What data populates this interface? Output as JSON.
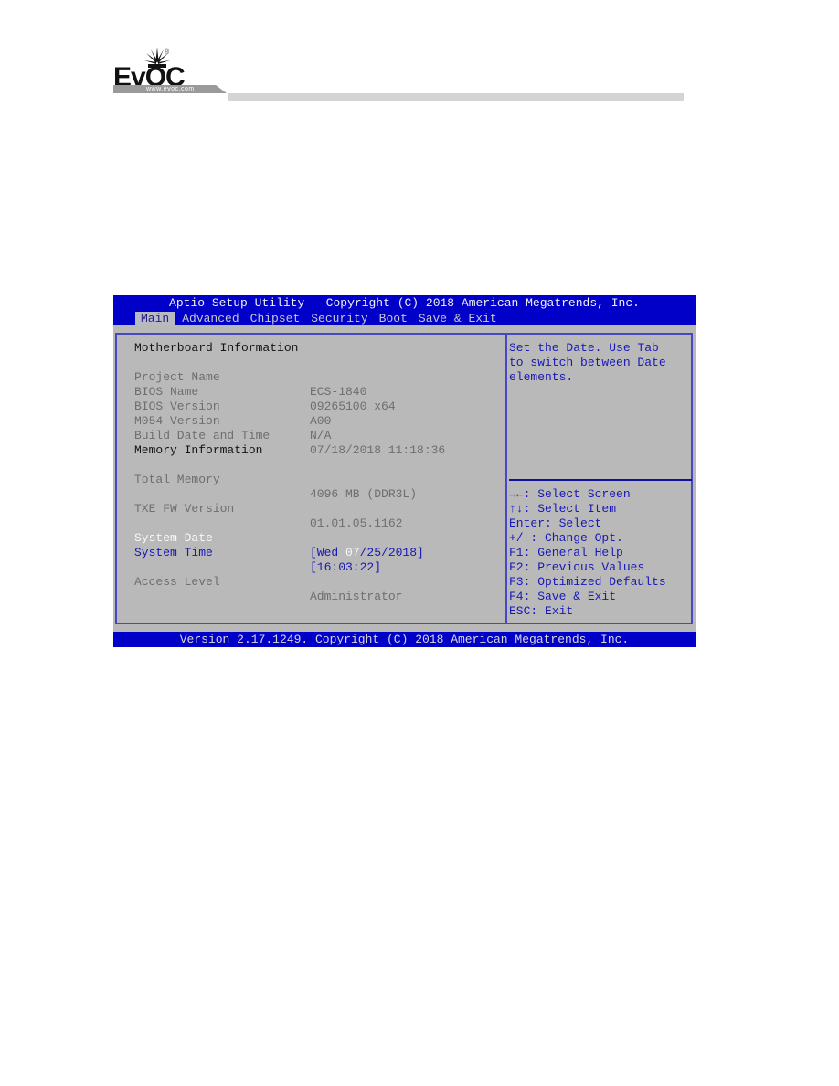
{
  "header": {
    "logo_text": "EvOC",
    "logo_url": "www.evoc.com",
    "registered_mark": "®"
  },
  "bios": {
    "title": "Aptio Setup Utility - Copyright (C) 2018 American Megatrends, Inc.",
    "tabs": [
      {
        "label": "Main",
        "active": true
      },
      {
        "label": "Advanced",
        "active": false
      },
      {
        "label": "Chipset",
        "active": false
      },
      {
        "label": "Security",
        "active": false
      },
      {
        "label": "Boot",
        "active": false
      },
      {
        "label": "Save & Exit",
        "active": false
      }
    ],
    "motherboard_heading": "Motherboard Information",
    "motherboard": [
      {
        "label": "Project Name",
        "value": "ECS-1840"
      },
      {
        "label": "BIOS Name",
        "value": "09265100 x64"
      },
      {
        "label": "BIOS Version",
        "value": "A00"
      },
      {
        "label": "M054 Version",
        "value": "N/A"
      },
      {
        "label": "Build Date and Time",
        "value": "07/18/2018 11:18:36"
      }
    ],
    "memory_heading": "Memory Information",
    "total_memory": {
      "label": "Total Memory",
      "value": "4096 MB (DDR3L)"
    },
    "txe_fw": {
      "label": "TXE FW Version",
      "value": "01.01.05.1162"
    },
    "system_date": {
      "label": "System Date",
      "value_prefix": "[Wed ",
      "value_selected": "07",
      "value_suffix": "/25/2018]"
    },
    "system_time": {
      "label": "System Time",
      "value": "[16:03:22]"
    },
    "access_level": {
      "label": "Access Level",
      "value": "Administrator"
    },
    "help_text": [
      "Set the Date. Use Tab",
      "to switch between Date",
      "elements."
    ],
    "key_help": [
      "→←: Select Screen",
      "↑↓: Select Item",
      "Enter: Select",
      "+/-: Change Opt.",
      "F1: General Help",
      "F2: Previous Values",
      "F3: Optimized Defaults",
      "F4: Save & Exit",
      "ESC: Exit"
    ],
    "footer": "Version 2.17.1249. Copyright (C) 2018 American Megatrends, Inc."
  },
  "colors": {
    "bios_blue": "#0000c8",
    "panel_grey": "#b9b9b9",
    "highlight_text": "#1818b8"
  }
}
